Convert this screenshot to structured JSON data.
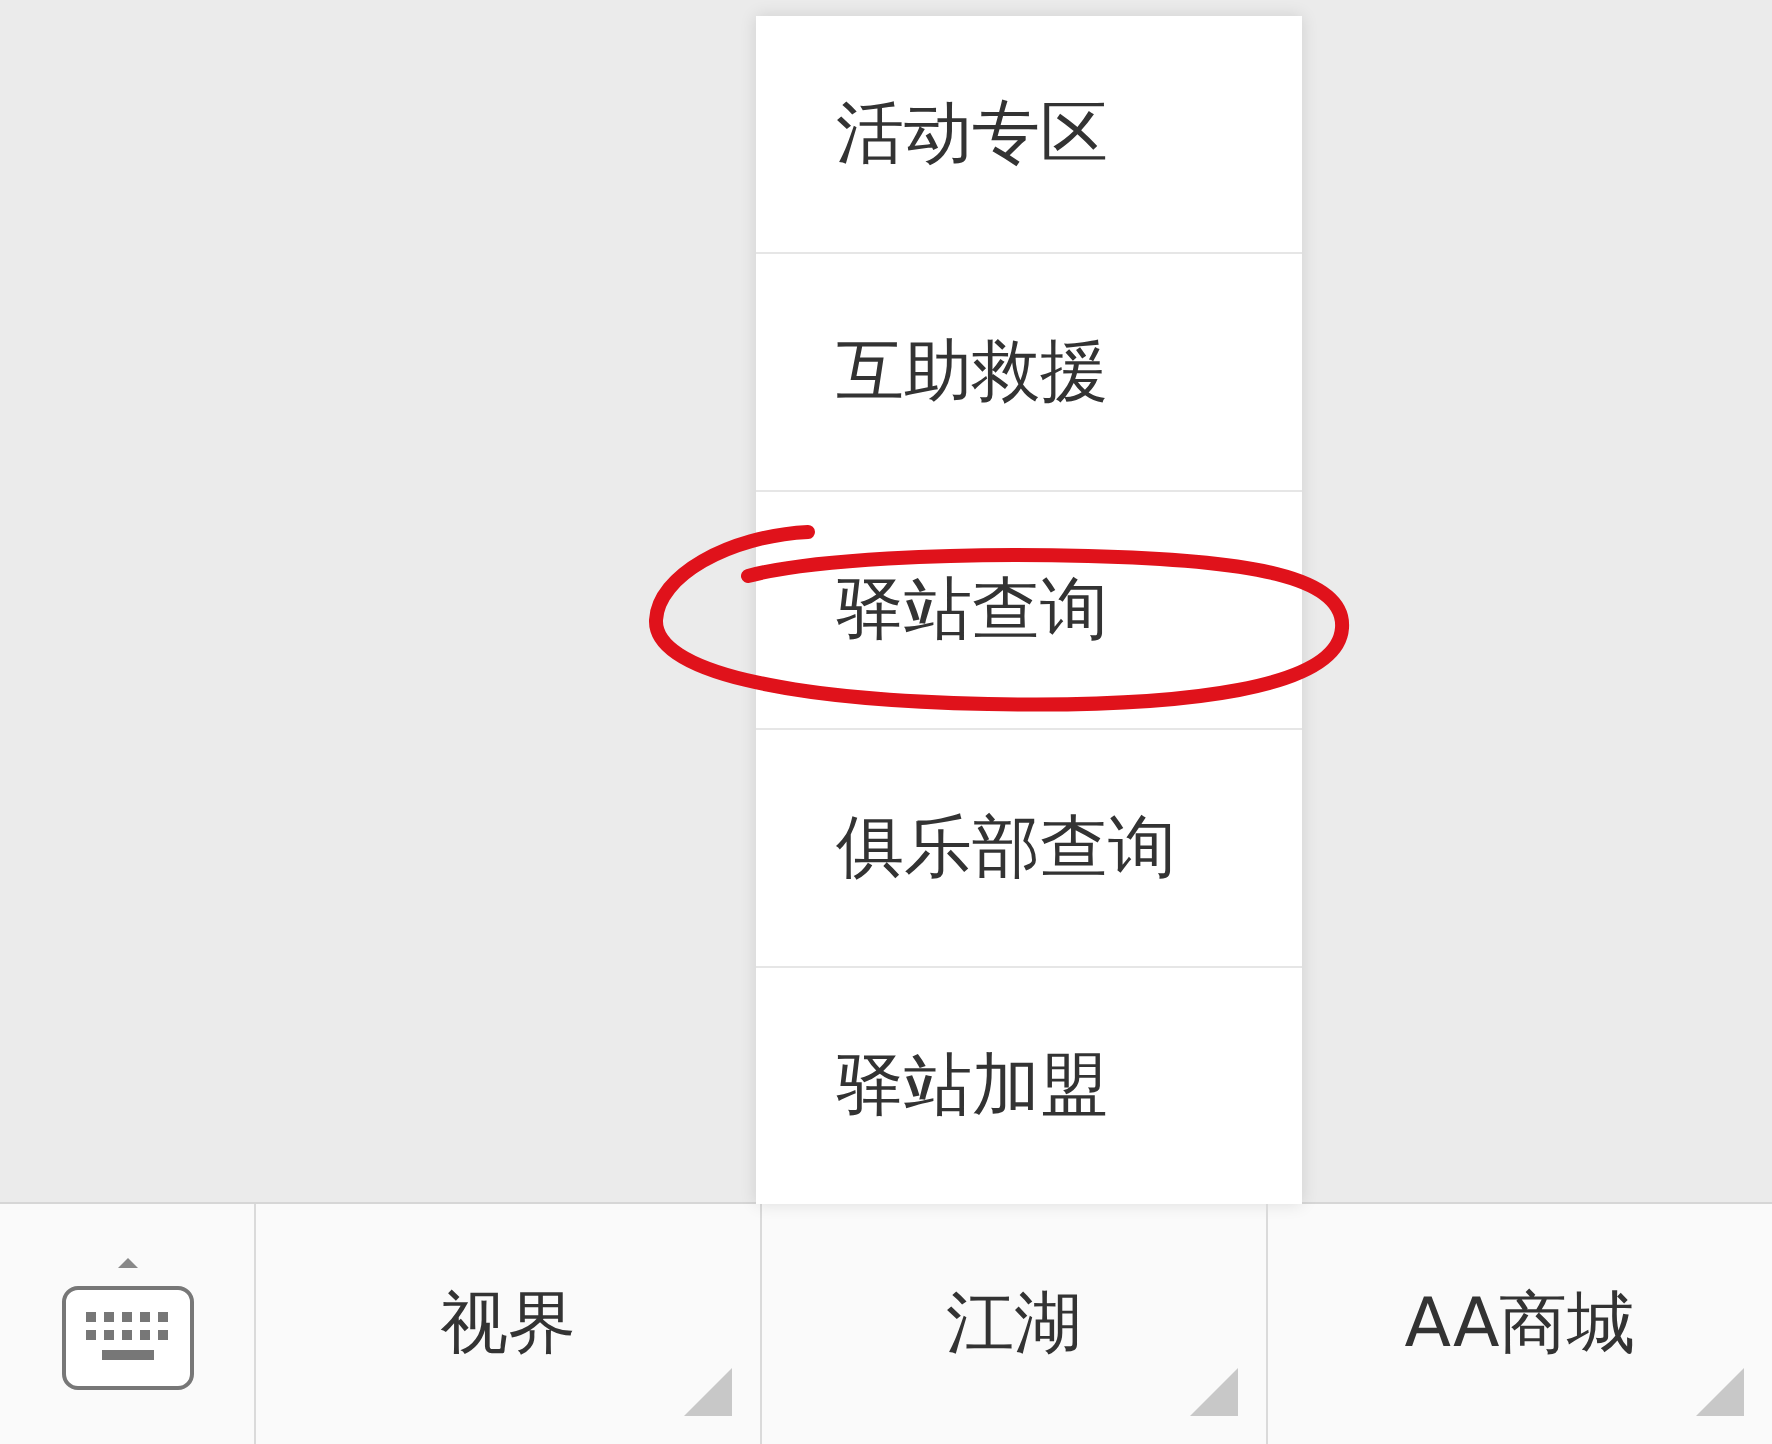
{
  "menu_popup": {
    "items": [
      {
        "label": "活动专区",
        "circled": false
      },
      {
        "label": "互助救援",
        "circled": false
      },
      {
        "label": "驿站查询",
        "circled": true
      },
      {
        "label": "俱乐部查询",
        "circled": false
      },
      {
        "label": "驿站加盟",
        "circled": false
      }
    ]
  },
  "bottom_bar": {
    "tabs": [
      {
        "kind": "keyboard"
      },
      {
        "kind": "menu",
        "label": "视界",
        "expanded": false
      },
      {
        "kind": "menu",
        "label": "江湖",
        "expanded": true
      },
      {
        "kind": "menu",
        "label": "AA商城",
        "expanded": false
      }
    ]
  }
}
